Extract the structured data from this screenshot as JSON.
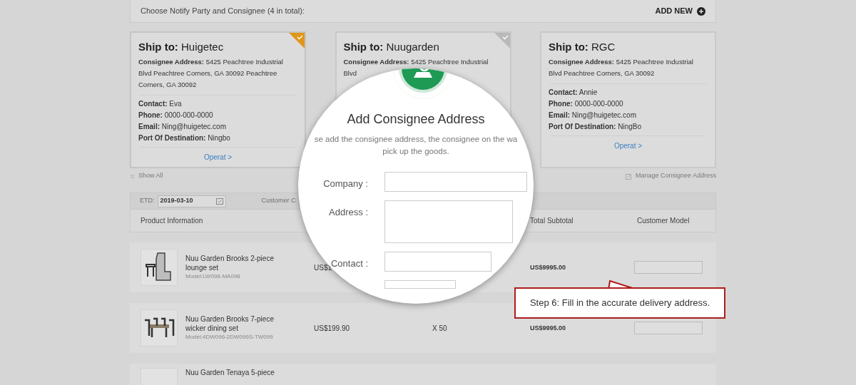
{
  "header": {
    "title": "Choose Notify Party and Consignee (4 in total):",
    "add_button": "ADD NEW"
  },
  "consignees": [
    {
      "ship_to_label": "Ship to:",
      "name": "Huigetec",
      "selected": true,
      "corner_shown": true,
      "address_label": "Consignee Address:",
      "address": "5425 Peachtree Industrial Blvd Peachtree Corners, GA 30092 Peachtree Corners, GA 30092",
      "details": [
        {
          "label": "Contact:",
          "value": "Eva"
        },
        {
          "label": "Phone:",
          "value": "0000-000-0000"
        },
        {
          "label": "Email:",
          "value": "Ning@huigetec.com"
        },
        {
          "label": "Port Of Destination:",
          "value": "Ningbo"
        }
      ],
      "link": "Operat >"
    },
    {
      "ship_to_label": "Ship to:",
      "name": "Nuugarden",
      "selected": false,
      "corner_shown": true,
      "address_label": "Consignee Address:",
      "address": "5425 Peachtree Industrial Blvd"
    },
    {
      "ship_to_label": "Ship to:",
      "name": "RGC",
      "selected": false,
      "corner_shown": false,
      "address_label": "Consignee Address:",
      "address": "5425 Peachtree Industrial Blvd Peachtree Corners, GA 30092",
      "details": [
        {
          "label": "Contact:",
          "value": "Annie"
        },
        {
          "label": "Phone:",
          "value": "0000-000-0000"
        },
        {
          "label": "Email:",
          "value": "Ning@huigetec.com"
        },
        {
          "label": "Port Of Destination:",
          "value": "NingBo"
        }
      ],
      "link": "Operat >"
    }
  ],
  "show_all": "Show All",
  "manage_link": "Manage Consignee Address",
  "etd": {
    "label": "ETD:",
    "value": "2019-03-10",
    "next_label": "Customer C"
  },
  "table": {
    "columns": [
      "Product Information",
      "Total Subtotal",
      "Customer Model"
    ],
    "rows": [
      {
        "name": "Nuu Garden Brooks 2-piece lounge set",
        "model": "Model:LW098-MA098",
        "price": "US$1",
        "subtotal": "US$9995.00",
        "kind": "lounge"
      },
      {
        "name": "Nuu Garden Brooks 7-piece wicker dining set",
        "model": "Model:4DW096-2DW096S-TW099",
        "price": "US$199.90",
        "quantity": "X 50",
        "subtotal": "US$9995.00",
        "kind": "dining"
      },
      {
        "name": "Nuu Garden Tenaya 5-piece",
        "kind": "partial"
      }
    ]
  },
  "magnifier": {
    "title": "Add Consignee Address",
    "description_lines": [
      "se add the consignee address, the consignee on the wa",
      "pick up the goods."
    ],
    "fields": [
      {
        "label": "Company :",
        "kind": "wide_input"
      },
      {
        "label": "Address :",
        "kind": "textarea"
      },
      {
        "label": "Contact :",
        "kind": "input"
      },
      {
        "kind": "short_input"
      }
    ]
  },
  "callout": "Step 6: Fill in the accurate delivery address."
}
